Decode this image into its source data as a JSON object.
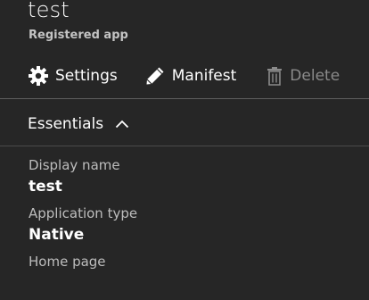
{
  "header": {
    "title": "test",
    "subtitle": "Registered app"
  },
  "toolbar": {
    "settings_label": "Settings",
    "manifest_label": "Manifest",
    "delete_label": "Delete",
    "icons": [
      "gear-icon",
      "pencil-icon",
      "trash-icon"
    ]
  },
  "essentials": {
    "title": "Essentials",
    "state": "expanded",
    "fields": [
      {
        "label": "Display name",
        "value": "test"
      },
      {
        "label": "Application type",
        "value": "Native"
      },
      {
        "label": "Home page",
        "value": ""
      }
    ]
  },
  "colors": {
    "background": "#262626",
    "text": "#ffffff",
    "muted_text": "#bdbdbd",
    "disabled_text": "#8a8a8a",
    "divider": "#5e5e5e"
  }
}
